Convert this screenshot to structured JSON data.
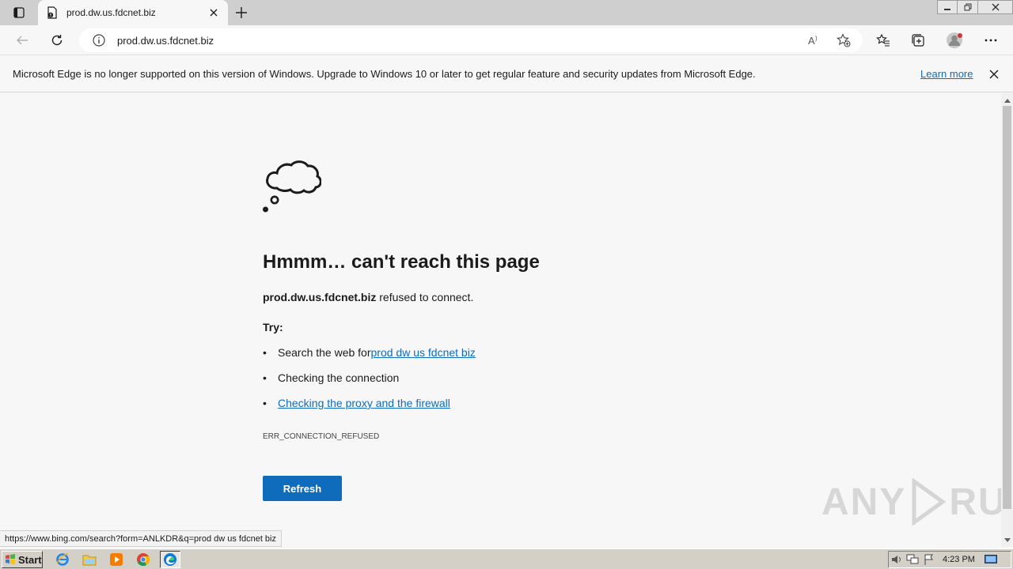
{
  "browser": {
    "tab": {
      "title": "prod.dw.us.fdcnet.biz"
    },
    "address": {
      "url": "prod.dw.us.fdcnet.biz"
    }
  },
  "infobar": {
    "message": "Microsoft Edge is no longer supported on this version of Windows. Upgrade to Windows 10 or later to get regular feature and security updates from Microsoft Edge.",
    "link": "Learn more"
  },
  "error_page": {
    "title": "Hmmm… can't reach this page",
    "host": "prod.dw.us.fdcnet.biz",
    "description_suffix": " refused to connect.",
    "try_label": "Try:",
    "suggestions": [
      {
        "prefix": "Search the web for ",
        "link": "prod dw us fdcnet biz"
      },
      {
        "text": "Checking the connection"
      },
      {
        "link": "Checking the proxy and the firewall"
      }
    ],
    "error_code": "ERR_CONNECTION_REFUSED",
    "refresh_label": "Refresh"
  },
  "status_bar": {
    "url": "https://www.bing.com/search?form=ANLKDR&q=prod dw us fdcnet biz"
  },
  "watermark": {
    "left": "ANY",
    "right": "RUN"
  },
  "taskbar": {
    "start_label": "Start",
    "apps": [
      "internet-explorer-icon",
      "file-explorer-icon",
      "media-player-icon",
      "chrome-icon",
      "edge-icon"
    ],
    "clock": "4:23 PM"
  },
  "colors": {
    "accent": "#0f6cbd",
    "page_bg": "#f7f7f7",
    "taskbar": "#d4d0c8"
  }
}
